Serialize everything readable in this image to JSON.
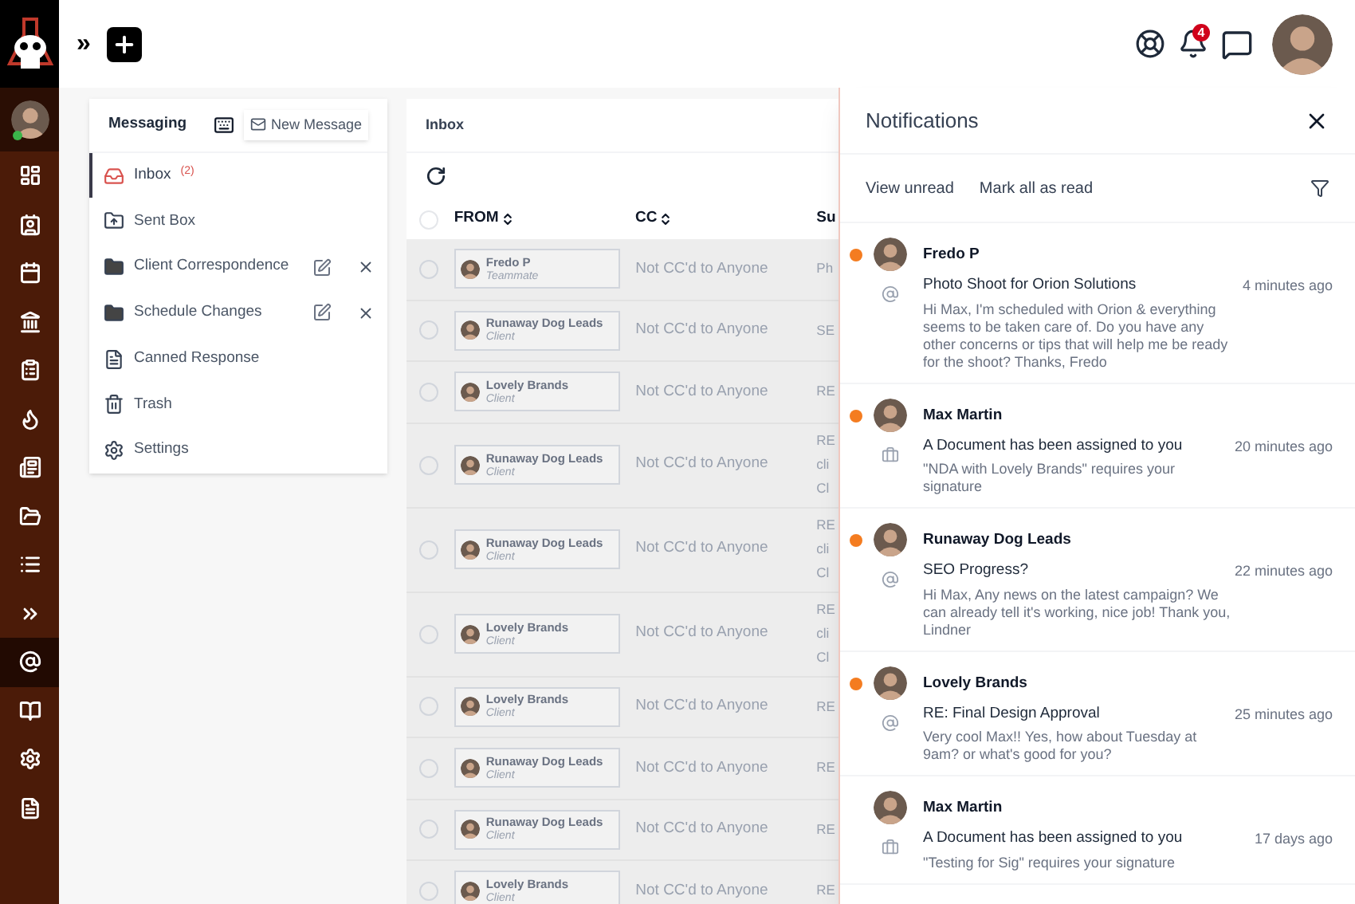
{
  "rail": [
    {
      "selected": false
    },
    {
      "selected": false
    },
    {
      "selected": false
    },
    {
      "selected": false
    },
    {
      "selected": false
    },
    {
      "selected": false
    },
    {
      "selected": false
    },
    {
      "selected": false
    },
    {
      "selected": false
    },
    {
      "selected": false
    },
    {
      "selected": true
    },
    {
      "selected": false
    },
    {
      "selected": false
    },
    {
      "selected": false
    }
  ],
  "topbar": {
    "expand": "»",
    "badge": "4"
  },
  "messaging": {
    "title": "Messaging",
    "new_message": "New Message",
    "folders": [
      {
        "kind": "inbox",
        "label": "Inbox",
        "count": "(2)",
        "selected": true
      },
      {
        "kind": "sent",
        "label": "Sent Box",
        "selected": false
      },
      {
        "kind": "custom",
        "label": "Client Correspondence",
        "selected": false
      },
      {
        "kind": "custom",
        "label": "Schedule Changes",
        "selected": false
      },
      {
        "kind": "canned",
        "label": "Canned Response",
        "selected": false
      },
      {
        "kind": "trash",
        "label": "Trash",
        "selected": false
      },
      {
        "kind": "settings",
        "label": "Settings",
        "selected": false
      }
    ]
  },
  "inbox": {
    "title": "Inbox",
    "select_all_checked": false,
    "columns": [
      "FROM",
      "CC",
      "Su"
    ],
    "rows": [
      {
        "checked": false,
        "name": "Fredo P",
        "role": "Teammate",
        "cc": "Not CC'd to Anyone",
        "subject": [
          "Ph"
        ]
      },
      {
        "checked": false,
        "name": "Runaway Dog Leads",
        "role": "Client",
        "cc": "Not CC'd to Anyone",
        "subject": [
          "SE"
        ]
      },
      {
        "checked": false,
        "name": "Lovely Brands",
        "role": "Client",
        "cc": "Not CC'd to Anyone",
        "subject": [
          "RE"
        ]
      },
      {
        "checked": false,
        "name": "Runaway Dog Leads",
        "role": "Client",
        "cc": "Not CC'd to Anyone",
        "subject": [
          "RE",
          "cli",
          "Cl"
        ]
      },
      {
        "checked": false,
        "name": "Runaway Dog Leads",
        "role": "Client",
        "cc": "Not CC'd to Anyone",
        "subject": [
          "RE",
          "cli",
          "Cl"
        ]
      },
      {
        "checked": false,
        "name": "Lovely Brands",
        "role": "Client",
        "cc": "Not CC'd to Anyone",
        "subject": [
          "RE",
          "cli",
          "Cl"
        ]
      },
      {
        "checked": false,
        "name": "Lovely Brands",
        "role": "Client",
        "cc": "Not CC'd to Anyone",
        "subject": [
          "RE"
        ]
      },
      {
        "checked": false,
        "name": "Runaway Dog Leads",
        "role": "Client",
        "cc": "Not CC'd to Anyone",
        "subject": [
          "RE"
        ]
      },
      {
        "checked": false,
        "name": "Runaway Dog Leads",
        "role": "Client",
        "cc": "Not CC'd to Anyone",
        "subject": [
          "RE"
        ]
      },
      {
        "checked": false,
        "name": "Lovely Brands",
        "role": "Client",
        "cc": "Not CC'd to Anyone",
        "subject": [
          "RE"
        ]
      }
    ]
  },
  "notifications": {
    "title": "Notifications",
    "view_unread": "View unread",
    "mark_all": "Mark all as read",
    "items": [
      {
        "kind": "mention",
        "unread": true,
        "name": "Fredo P",
        "title": "Photo Shoot for Orion Solutions",
        "body": "Hi Max, I'm scheduled with Orion & everything seems to be taken care of. Do you have any other concerns or tips that will help me be ready for the shoot? Thanks, Fredo",
        "time": "4 minutes ago"
      },
      {
        "kind": "document",
        "unread": true,
        "name": "Max Martin",
        "title": "A Document has been assigned to you",
        "body": "\"NDA with Lovely Brands\" requires your signature",
        "time": "20 minutes ago"
      },
      {
        "kind": "mention",
        "unread": true,
        "name": "Runaway Dog Leads",
        "title": "SEO Progress?",
        "body": "Hi Max, Any news on the latest campaign? We can already tell it's working, nice job! Thank you, Lindner",
        "time": "22 minutes ago"
      },
      {
        "kind": "mention",
        "unread": true,
        "name": "Lovely Brands",
        "title": "RE: Final Design Approval",
        "body": "Very cool Max!! Yes, how about Tuesday at 9am? or what's good for you?",
        "time": "25 minutes ago"
      },
      {
        "kind": "document",
        "unread": false,
        "name": "Max Martin",
        "title": "A Document has been assigned to you",
        "body": "\"Testing for Sig\" requires your signature",
        "time": "17 days ago"
      }
    ]
  }
}
